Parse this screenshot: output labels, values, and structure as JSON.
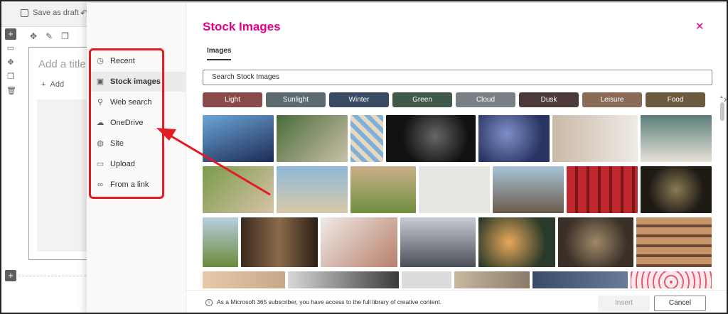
{
  "editor": {
    "save_draft_label": "Save as draft",
    "add_title_placeholder": "Add a title",
    "add_label": "Add"
  },
  "nav": {
    "items": [
      {
        "label": "Recent",
        "icon": "clock-icon"
      },
      {
        "label": "Stock images",
        "icon": "image-icon",
        "selected": true
      },
      {
        "label": "Web search",
        "icon": "search-icon"
      },
      {
        "label": "OneDrive",
        "icon": "cloud-icon"
      },
      {
        "label": "Site",
        "icon": "globe-icon"
      },
      {
        "label": "Upload",
        "icon": "laptop-icon"
      },
      {
        "label": "From a link",
        "icon": "link-icon"
      }
    ]
  },
  "panel": {
    "title": "Stock Images",
    "close_icon": "close-icon",
    "tab_label": "Images",
    "search_placeholder": "Search Stock Images",
    "categories": [
      "Light",
      "Sunlight",
      "Winter",
      "Green",
      "Cloud",
      "Dusk",
      "Leisure",
      "Food"
    ],
    "footer_note": "As a Microsoft 365 subscriber, you have access to the full library of creative content.",
    "insert_label": "Insert",
    "cancel_label": "Cancel"
  },
  "colors": {
    "accent": "#e3008c",
    "highlight": "#e31b23"
  }
}
